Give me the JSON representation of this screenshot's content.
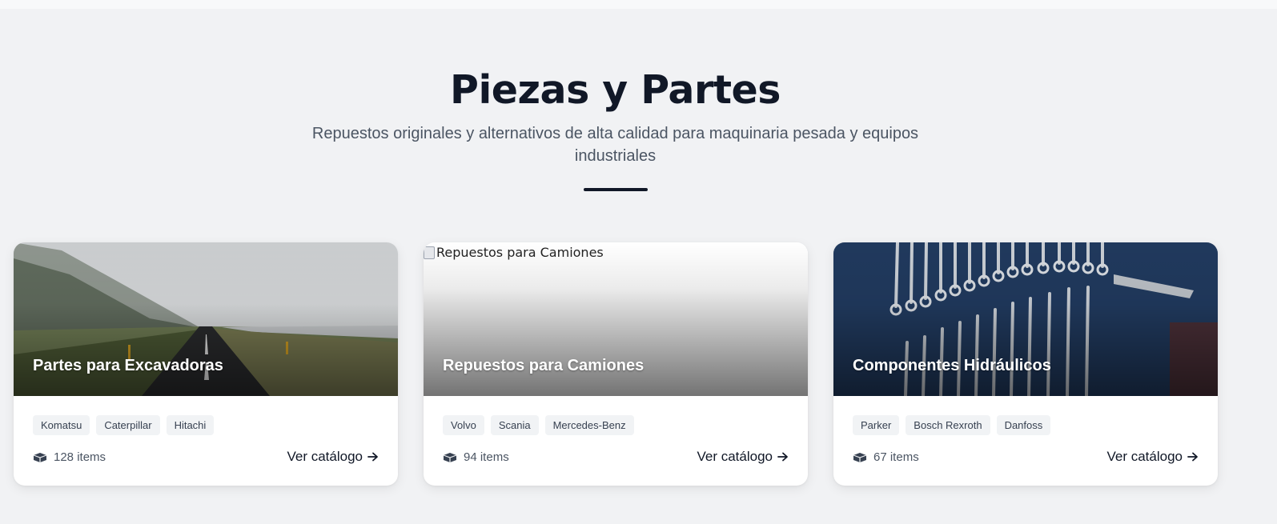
{
  "section": {
    "title": "Piezas y Partes",
    "subtitle": "Repuestos originales y alternativos de alta calidad para maquinaria pesada y equipos industriales"
  },
  "cards": [
    {
      "title": "Partes para Excavadoras",
      "tags": [
        "Komatsu",
        "Caterpillar",
        "Hitachi"
      ],
      "count": "128 items",
      "cta": "Ver catálogo",
      "image_alt": ""
    },
    {
      "title": "Repuestos para Camiones",
      "tags": [
        "Volvo",
        "Scania",
        "Mercedes-Benz"
      ],
      "count": "94 items",
      "cta": "Ver catálogo",
      "image_alt": "Repuestos para Camiones"
    },
    {
      "title": "Componentes Hidráulicos",
      "tags": [
        "Parker",
        "Bosch Rexroth",
        "Danfoss"
      ],
      "count": "67 items",
      "cta": "Ver catálogo",
      "image_alt": ""
    }
  ],
  "icons": {
    "count_icon": "boxes-icon",
    "cta_icon": "arrow-right-icon"
  },
  "colors": {
    "background": "#f1f2f4",
    "text_dark": "#111827",
    "text_muted": "#4b5563",
    "tag_bg": "#f1f3f5"
  }
}
